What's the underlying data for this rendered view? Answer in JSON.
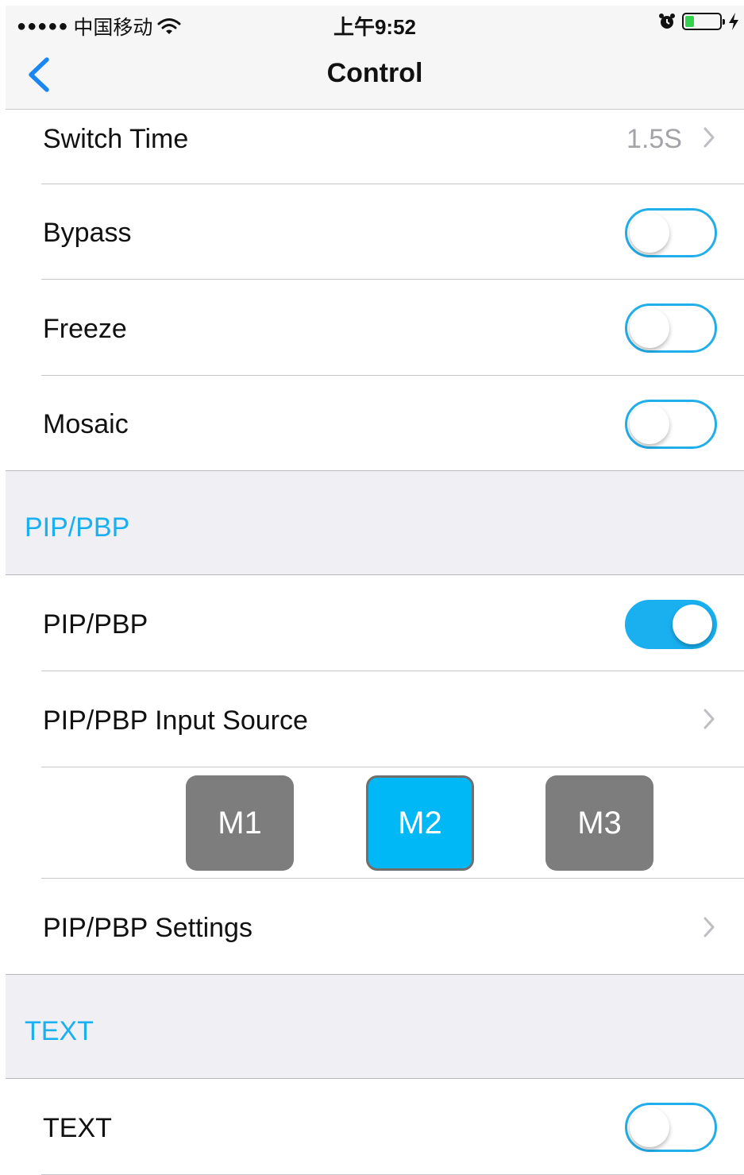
{
  "status_bar": {
    "signal": "●●●●●",
    "carrier": "中国移动",
    "time": "上午9:52",
    "battery_percent": 25,
    "icons": [
      "signal-dots-icon",
      "wifi-icon",
      "alarm-clock-icon",
      "battery-icon",
      "charging-bolt-icon"
    ]
  },
  "nav": {
    "title": "Control",
    "back_icon": "chevron-left-icon"
  },
  "rows": {
    "switch_time": {
      "label": "Switch Time",
      "value": "1.5S"
    },
    "bypass": {
      "label": "Bypass",
      "on": false
    },
    "freeze": {
      "label": "Freeze",
      "on": false
    },
    "mosaic": {
      "label": "Mosaic",
      "on": false
    }
  },
  "sections": {
    "pip": {
      "header": "PIP/PBP",
      "toggle": {
        "label": "PIP/PBP",
        "on": true
      },
      "input_source": {
        "label": "PIP/PBP Input Source"
      },
      "modes": [
        {
          "label": "M1",
          "selected": false
        },
        {
          "label": "M2",
          "selected": true
        },
        {
          "label": "M3",
          "selected": false
        }
      ],
      "settings": {
        "label": "PIP/PBP Settings"
      }
    },
    "text": {
      "header": "TEXT",
      "toggle": {
        "label": "TEXT",
        "on": false
      }
    }
  },
  "colors": {
    "accent": "#1ab0f0",
    "toggle_border": "#22aeea",
    "mode_default": "#7d7d7d",
    "mode_selected": "#00b8f5",
    "section_bg": "#efeff4",
    "value_gray": "#a3a3a8"
  }
}
